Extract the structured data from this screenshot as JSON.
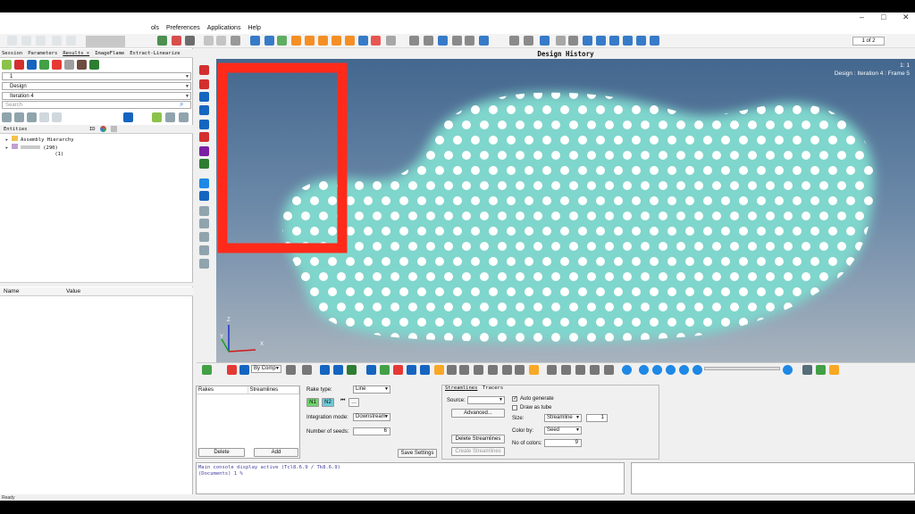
{
  "window": {
    "minimize": "–",
    "maximize": "□",
    "close": "✕"
  },
  "menu": [
    "ols",
    "Preferences",
    "Applications",
    "Help"
  ],
  "toolbar": {
    "page_indicator": "1 of 2"
  },
  "left_panel": {
    "tabs": [
      "Session",
      "Parameters",
      "Results ×",
      "ImageFlame",
      "Extract-Linearize"
    ],
    "selectors": [
      "1",
      "Design",
      "Iteration 4"
    ],
    "search_placeholder": "Search",
    "tree_header": "Entities",
    "tree_header_id": "ID",
    "tree_items": [
      "Assembly Hierarchy",
      "(290)",
      "(1)"
    ],
    "props_columns": [
      "Name",
      "Value"
    ]
  },
  "viewport": {
    "title": "Design History",
    "scale": "1: 1",
    "frame_label": "Design : Iteration 4 : Frame 5",
    "axis": {
      "z": "Z",
      "y": "Y",
      "x": "X"
    },
    "highlight_color": "#ff2a1a",
    "surface_color": "#7fd6cc"
  },
  "bottom_toolbar": {
    "component_select": "By Comp"
  },
  "rakes_panel": {
    "columns": [
      "Rakes",
      "Streamlines"
    ],
    "delete_label": "Delete",
    "add_label": "Add"
  },
  "rake_settings": {
    "rake_type_label": "Rake type:",
    "rake_type_value": "Line",
    "n1": "N1",
    "n2": "N2",
    "integration_label": "Integration mode:",
    "integration_value": "Downstream",
    "seeds_label": "Number of seeds:",
    "seeds_value": "6",
    "save_settings": "Save Settings"
  },
  "streamlines_panel": {
    "tabs": [
      "Streamlines",
      "Tracers"
    ],
    "source_label": "Source:",
    "advanced_label": "Advanced...",
    "delete_streamlines": "Delete Streamlines",
    "create_streamlines": "Create Streamlines",
    "auto_generate": "Auto generate",
    "draw_as_tube": "Draw as tube",
    "size_label": "Size:",
    "size_value": "Streamline",
    "size_number": "1",
    "color_by_label": "Color by:",
    "color_by_value": "Seed",
    "num_colors_label": "No of colors:",
    "num_colors_value": "9"
  },
  "console": {
    "line1": "Main console display active (Tcl8.6.9 / Tk8.6.9)",
    "line2": "(Documents) 1 %"
  },
  "status": {
    "text": "Ready"
  }
}
